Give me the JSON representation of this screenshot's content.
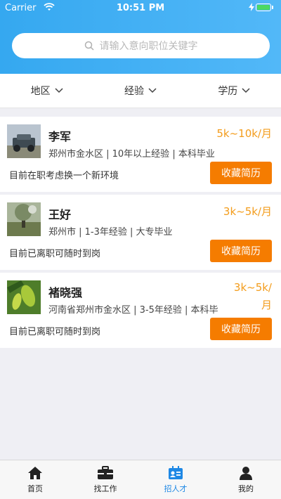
{
  "status_bar": {
    "carrier": "Carrier",
    "time": "10:51 PM"
  },
  "search": {
    "placeholder": "请输入意向职位关键字",
    "icon": "search-icon"
  },
  "filters": [
    {
      "label": "地区"
    },
    {
      "label": "经验"
    },
    {
      "label": "学历"
    }
  ],
  "candidates": [
    {
      "name": "李军",
      "salary": "5k~10k/月",
      "meta": "郑州市金水区 | 10年以上经验 | 本科毕业",
      "status": "目前在职考虑换一个新环境",
      "button": "收藏简历",
      "avatar": "jeep-photo"
    },
    {
      "name": "王好",
      "salary": "3k~5k/月",
      "meta": "郑州市 | 1-3年经验 | 大专毕业",
      "status": "目前已离职可随时到岗",
      "button": "收藏简历",
      "avatar": "foggy-tree-photo"
    },
    {
      "name": "褚晓强",
      "salary": "3k~5k/月",
      "meta": "河南省郑州市金水区 | 3-5年经验 | 本科毕",
      "status": "目前已离职可随时到岗",
      "button": "收藏简历",
      "avatar": "starfruit-photo"
    }
  ],
  "tabs": [
    {
      "label": "首页",
      "icon": "home-icon"
    },
    {
      "label": "找工作",
      "icon": "briefcase-icon"
    },
    {
      "label": "招人才",
      "icon": "contact-card-icon",
      "active": true
    },
    {
      "label": "我的",
      "icon": "user-icon"
    }
  ],
  "colors": {
    "header": "#3aabf2",
    "accent_orange": "#f57c00",
    "salary_orange": "#f39c1b",
    "active_tab": "#1e88e5"
  }
}
